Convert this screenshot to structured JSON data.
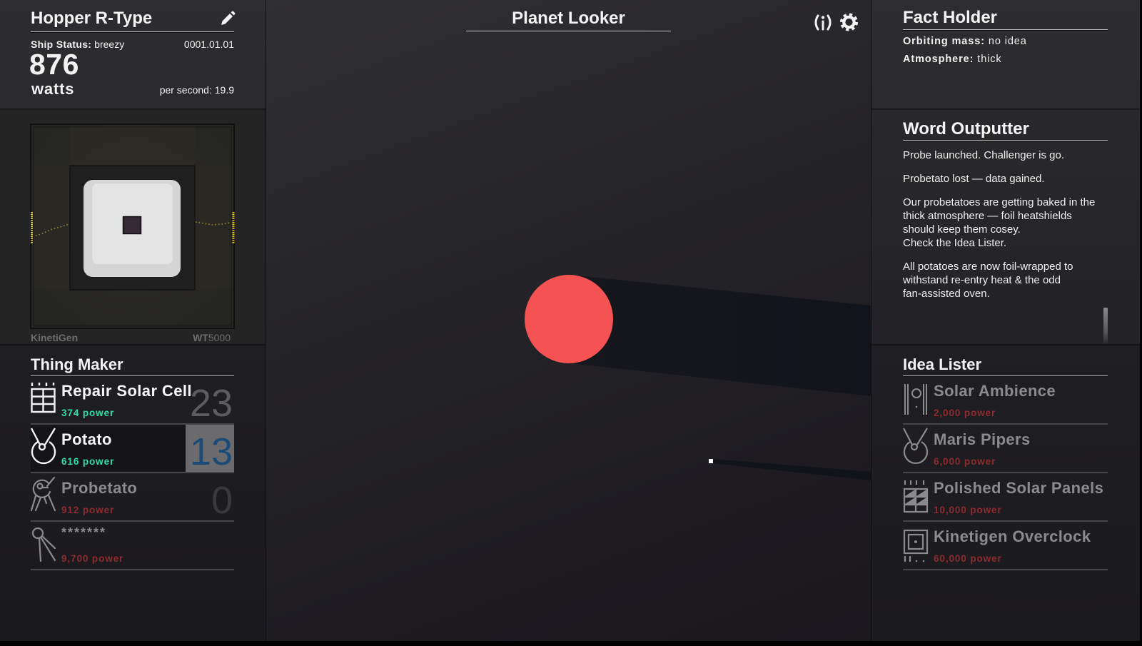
{
  "colors": {
    "affordable_cost": "#2fe0a6",
    "unaffordable_cost": "#8f2a2e",
    "selected_count": "#1c4b79",
    "planet": "#f55353",
    "generator_indicator": "#e8c51e"
  },
  "ship": {
    "name": "Hopper R-Type",
    "edit_icon": "pencil-icon",
    "status_label": "Ship Status:",
    "status_value": " breezy",
    "date": "0001.01.01",
    "power_value": "876",
    "power_unit": "watts",
    "rate_label": "per second: ",
    "rate_value": "19.9"
  },
  "generator": {
    "brand": "KinetiGen",
    "model_prefix": "WT",
    "model_number": "5000"
  },
  "thing_maker": {
    "title": "Thing Maker",
    "items": [
      {
        "name": "Repair Solar Cell",
        "cost": "374 power",
        "count": "23",
        "state": "affordable",
        "icon": "solar-cell-icon"
      },
      {
        "name": "Potato",
        "cost": "616 power",
        "count": "13",
        "state": "affordable-selected",
        "icon": "potato-icon"
      },
      {
        "name": "Probetato",
        "cost": "912 power",
        "count": "0",
        "state": "unaffordable",
        "icon": "probetato-icon"
      },
      {
        "name": "*******",
        "cost": "9,700 power",
        "state": "locked",
        "icon": "sputnik-icon"
      }
    ]
  },
  "planet_looker": {
    "title": "Planet Looker",
    "info_icon": "info-icon",
    "settings_icon": "gear-icon"
  },
  "fact_holder": {
    "title": "Fact Holder",
    "facts": [
      {
        "label": "Orbiting mass:",
        "value": " no idea"
      },
      {
        "label": "Atmosphere:",
        "value": " thick"
      }
    ]
  },
  "word_outputter": {
    "title": "Word Outputter",
    "messages": [
      {
        "lines": [
          "Probe launched. Challenger is go."
        ]
      },
      {
        "lines": [
          "Probetato lost — data gained."
        ]
      },
      {
        "lines": [
          "Our probetatoes are getting baked in the",
          "thick atmosphere — foil heatshields",
          "should keep them cosey.",
          "Check the Idea Lister."
        ]
      },
      {
        "lines": [
          "All potatoes are now foil-wrapped to",
          "withstand re-entry heat & the odd",
          "fan-assisted oven."
        ]
      }
    ]
  },
  "idea_lister": {
    "title": "Idea Lister",
    "items": [
      {
        "name": "Solar Ambience",
        "cost": "2,000 power",
        "state": "unaffordable",
        "icon": "solar-ambience-icon"
      },
      {
        "name": "Maris Pipers",
        "cost": "6,000 power",
        "state": "unaffordable",
        "icon": "potato-icon"
      },
      {
        "name": "Polished Solar Panels",
        "cost": "10,000 power",
        "state": "unaffordable",
        "icon": "polished-panels-icon"
      },
      {
        "name": "Kinetigen Overclock",
        "cost": "60,000 power",
        "state": "unaffordable",
        "icon": "overclock-icon"
      }
    ]
  }
}
